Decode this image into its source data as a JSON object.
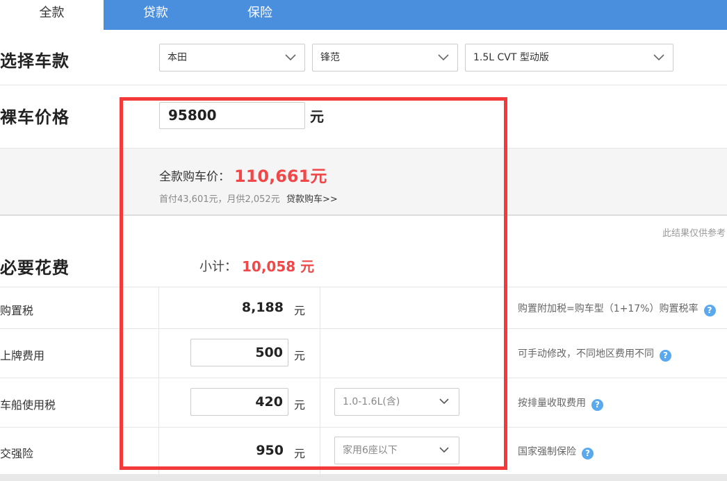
{
  "tabs": [
    {
      "label": "全款",
      "active": true
    },
    {
      "label": "贷款",
      "active": false
    },
    {
      "label": "保险",
      "active": false
    }
  ],
  "select_car": {
    "title": "选择车款",
    "brand": "本田",
    "series": "锋范",
    "model": "1.5L CVT 型动版"
  },
  "bare_price": {
    "title": "裸车价格",
    "value": "95800",
    "unit": "元"
  },
  "summary": {
    "total_label": "全款购车价：",
    "total_value": "110,661元",
    "sub_info": "首付43,601元，月供2,052元",
    "loan_link": "贷款购车>>"
  },
  "disclaimer": "此结果仅供参考",
  "required_fees": {
    "title": "必要花费",
    "subtotal_label": "小计：",
    "subtotal_value": "10,058 元",
    "rows": [
      {
        "label": "购置税",
        "amount": "8,188",
        "unit": "元",
        "editable": false,
        "note": "购置附加税=购车型（1+17%）购置税率"
      },
      {
        "label": "上牌费用",
        "amount": "500",
        "unit": "元",
        "editable": true,
        "note": "可手动修改，不同地区费用不同"
      },
      {
        "label": "车船使用税",
        "amount": "420",
        "unit": "元",
        "editable": true,
        "option": "1.0-1.6L(含)",
        "note": "按排量收取费用"
      },
      {
        "label": "交强险",
        "amount": "950",
        "unit": "元",
        "editable": false,
        "option": "家用6座以下",
        "note": "国家强制保险"
      }
    ]
  },
  "colors": {
    "tab_bar": "#4a8ede",
    "accent_red": "#f04848",
    "highlight_border": "#f23a3a",
    "help_icon": "#5aa9ef"
  },
  "icons": {
    "dropdown": "chevron-down-icon",
    "help": "question-mark-icon"
  }
}
